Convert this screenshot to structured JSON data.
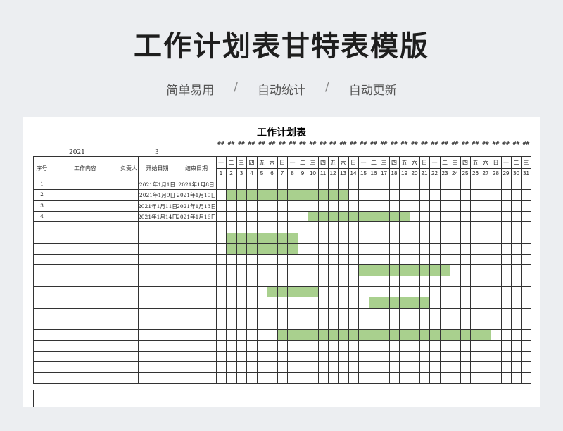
{
  "page": {
    "title": "工作计划表甘特表模版",
    "features": [
      "简单易用",
      "自动统计",
      "自动更新"
    ],
    "separator": "/"
  },
  "sheet": {
    "title": "工作计划表",
    "year": "2021",
    "month": "3",
    "overflow_marker": "##",
    "headers": {
      "seq": "序号",
      "content": "工作内容",
      "owner": "负责人",
      "start": "开始日期",
      "end": "结束日期"
    },
    "weekdays": [
      "一",
      "二",
      "三",
      "四",
      "五",
      "六",
      "日",
      "一",
      "二",
      "三",
      "四",
      "五",
      "六",
      "日",
      "一",
      "二",
      "三",
      "四",
      "五",
      "六",
      "日",
      "一",
      "二",
      "三",
      "四",
      "五",
      "六",
      "日",
      "一",
      "二",
      "三"
    ],
    "day_numbers": [
      "1",
      "2",
      "3",
      "4",
      "5",
      "6",
      "7",
      "8",
      "9",
      "10",
      "11",
      "12",
      "13",
      "14",
      "15",
      "16",
      "17",
      "18",
      "19",
      "20",
      "21",
      "22",
      "23",
      "24",
      "25",
      "26",
      "27",
      "28",
      "29",
      "30",
      "31"
    ],
    "tasks": [
      {
        "seq": "1",
        "content": "",
        "owner": "",
        "start": "2021年1月1日",
        "end": "2021年1月8日"
      },
      {
        "seq": "2",
        "content": "",
        "owner": "",
        "start": "2021年1月9日",
        "end": "2021年1月10日"
      },
      {
        "seq": "3",
        "content": "",
        "owner": "",
        "start": "2021年1月11日",
        "end": "2021年1月13日"
      },
      {
        "seq": "4",
        "content": "",
        "owner": "",
        "start": "2021年1月14日",
        "end": "2021年1月16日"
      }
    ],
    "bar_color": "#a9d08e",
    "bars": [
      {
        "row": 2,
        "from_day": 2,
        "to_day": 13
      },
      {
        "row": 4,
        "from_day": 10,
        "to_day": 19
      },
      {
        "row": 6,
        "from_day": 2,
        "to_day": 8
      },
      {
        "row": 7,
        "from_day": 2,
        "to_day": 8
      },
      {
        "row": 9,
        "from_day": 15,
        "to_day": 23
      },
      {
        "row": 11,
        "from_day": 6,
        "to_day": 10
      },
      {
        "row": 12,
        "from_day": 16,
        "to_day": 21
      },
      {
        "row": 15,
        "from_day": 7,
        "to_day": 27
      }
    ]
  }
}
